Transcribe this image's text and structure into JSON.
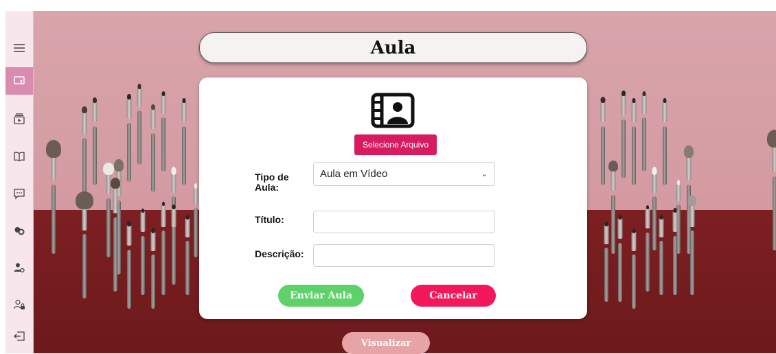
{
  "sidebar": {
    "items": [
      {
        "icon": "menu-icon"
      },
      {
        "icon": "lesson-screen-icon",
        "active": true
      },
      {
        "icon": "video-playlist-icon"
      },
      {
        "icon": "book-icon"
      },
      {
        "icon": "chat-icon"
      },
      {
        "icon": "community-icon"
      },
      {
        "icon": "user-settings-icon"
      },
      {
        "icon": "user-lock-icon"
      },
      {
        "icon": "logout-icon"
      }
    ]
  },
  "header": {
    "title": "Aula"
  },
  "form": {
    "upload_icon": "video-user-icon",
    "select_file_label": "Selecione Arquivo",
    "type_label": "Tipo de Aula:",
    "type_value": "Aula em Vídeo",
    "title_label": "Título:",
    "title_value": "",
    "description_label": "Descrição:",
    "description_value": "",
    "send_label": "Enviar Aula",
    "cancel_label": "Cancelar"
  },
  "footer": {
    "view_label": "Visualizar"
  },
  "colors": {
    "accent": "#d81b60",
    "send": "#5fd16a",
    "cancel": "#f2185b",
    "sidebar_active": "#d98cb0"
  }
}
